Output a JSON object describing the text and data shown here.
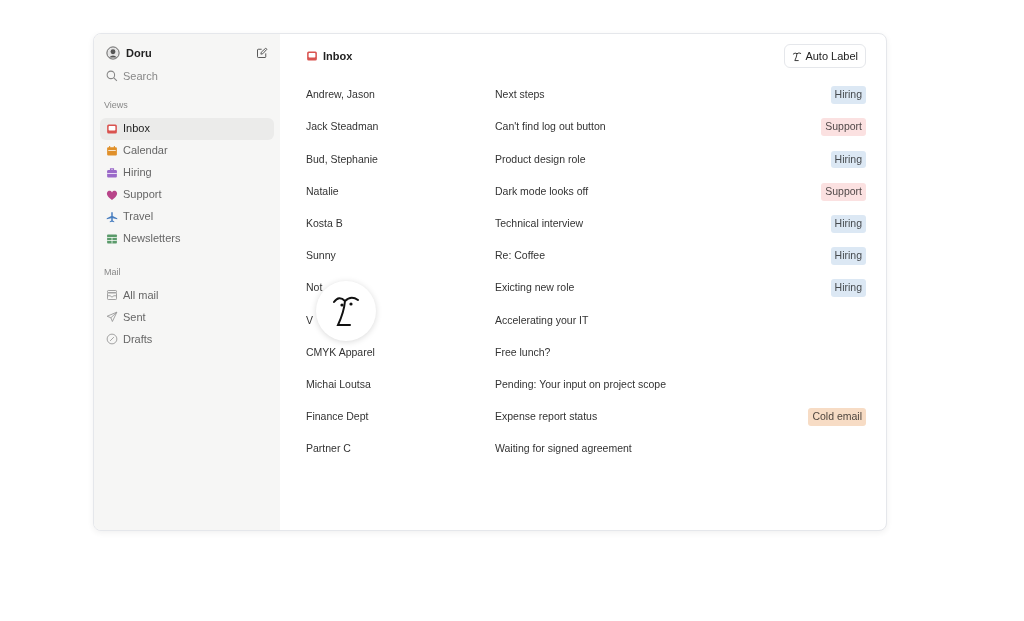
{
  "sidebar": {
    "user": "Doru",
    "search": "Search",
    "sections": [
      {
        "title": "Views",
        "items": [
          {
            "label": "Inbox",
            "selected": true,
            "color": "#d9534f"
          },
          {
            "label": "Calendar",
            "selected": false,
            "color": "#e0902a"
          },
          {
            "label": "Hiring",
            "selected": false,
            "color": "#9b6ac9"
          },
          {
            "label": "Support",
            "selected": false,
            "color": "#b8458a"
          },
          {
            "label": "Travel",
            "selected": false,
            "color": "#4a7fc0"
          },
          {
            "label": "Newsletters",
            "selected": false,
            "color": "#5a9a6a"
          }
        ]
      },
      {
        "title": "Mail",
        "items": [
          {
            "label": "All mail",
            "selected": false
          },
          {
            "label": "Sent",
            "selected": false
          },
          {
            "label": "Drafts",
            "selected": false
          }
        ]
      }
    ]
  },
  "main": {
    "title": "Inbox",
    "auto_label_button": "Auto Label",
    "rows": [
      {
        "sender": "Andrew, Jason",
        "subject": "Next steps",
        "tag": {
          "label": "Hiring",
          "color": "#dce8f4"
        }
      },
      {
        "sender": "Jack Steadman",
        "subject": "Can't find log out button",
        "tag": {
          "label": "Support",
          "color": "#fbe1e1"
        }
      },
      {
        "sender": "Bud, Stephanie",
        "subject": "Product design role",
        "tag": {
          "label": "Hiring",
          "color": "#dce8f4"
        }
      },
      {
        "sender": "Natalie",
        "subject": "Dark mode looks off",
        "tag": {
          "label": "Support",
          "color": "#fbe1e1"
        }
      },
      {
        "sender": "Kosta B",
        "subject": "Technical interview",
        "tag": {
          "label": "Hiring",
          "color": "#dce8f4"
        }
      },
      {
        "sender": "Sunny",
        "subject": "Re: Coffee",
        "tag": {
          "label": "Hiring",
          "color": "#dce8f4"
        }
      },
      {
        "sender": "Not",
        "subject": "Exicting new role",
        "tag": {
          "label": "Hiring",
          "color": "#dce8f4"
        }
      },
      {
        "sender": "V",
        "subject": "Accelerating your IT"
      },
      {
        "sender": "CMYK Apparel",
        "subject": "Free lunch?"
      },
      {
        "sender": "Michai Loutsa",
        "subject": "Pending: Your input on project scope"
      },
      {
        "sender": "Finance Dept",
        "subject": "Expense report status",
        "tag": {
          "label": "Cold email",
          "color": "#f7dcc5"
        }
      },
      {
        "sender": "Partner C",
        "subject": "Waiting for signed agreement"
      }
    ]
  }
}
